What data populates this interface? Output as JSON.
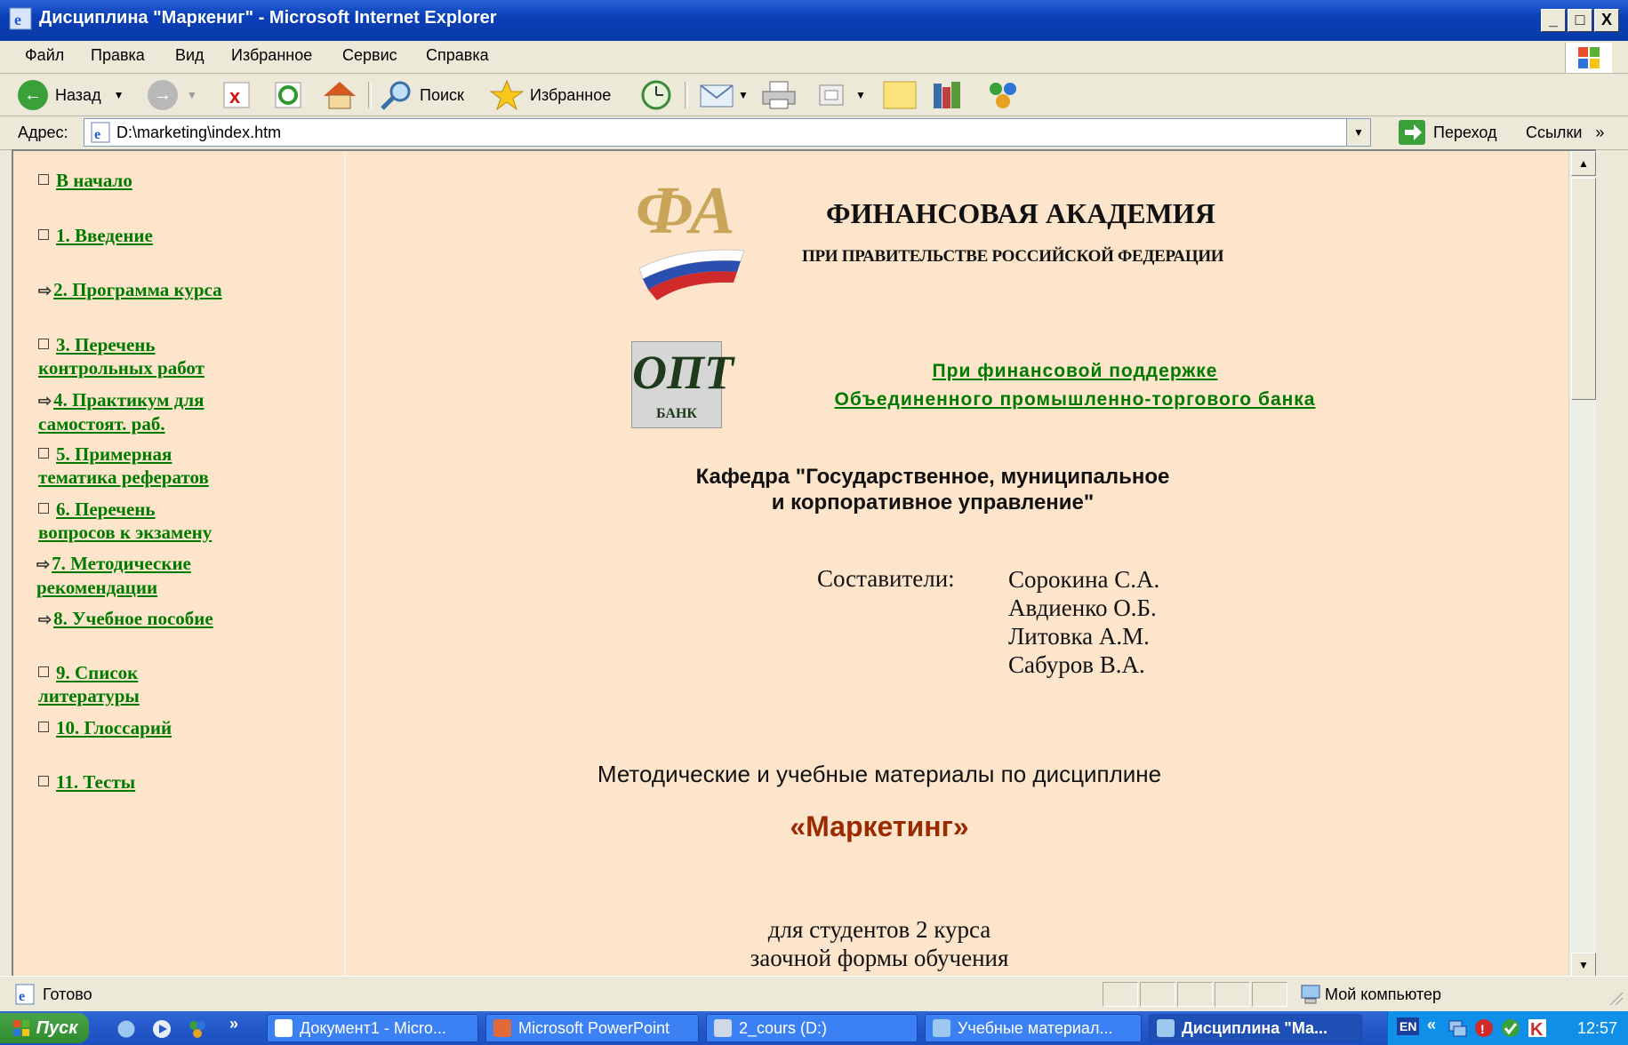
{
  "window": {
    "title": "Дисциплина \"Маркениг\" - Microsoft Internet Explorer",
    "controls": {
      "minimize": "_",
      "maximize": "□",
      "close": "X"
    }
  },
  "menu": [
    "Файл",
    "Правка",
    "Вид",
    "Избранное",
    "Сервис",
    "Справка"
  ],
  "toolbar": {
    "back": "Назад",
    "search": "Поиск",
    "favorites": "Избранное"
  },
  "address": {
    "label": "Адрес:",
    "value": "D:\\marketing\\index.htm",
    "go": "Переход",
    "links": "Ссылки",
    "more": "»"
  },
  "nav": [
    {
      "label": "В начало",
      "bullet": "square"
    },
    {
      "label": "1. Введение",
      "bullet": "square"
    },
    {
      "label": "2. Программа курса",
      "bullet": "arrow"
    },
    {
      "label": "3. Перечень контрольных работ",
      "bullet": "square",
      "line1": "3. Перечень",
      "line2": "контрольных работ"
    },
    {
      "label": "4. Практикум для самостоят. раб.",
      "bullet": "arrow",
      "line1": "4. Практикум для",
      "line2": "самостоят. раб."
    },
    {
      "label": "5. Примерная тематика рефератов",
      "bullet": "square",
      "line1": "5. Примерная",
      "line2": "тематика рефератов"
    },
    {
      "label": "6. Перечень вопросов к экзамену",
      "bullet": "square",
      "line1": "6. Перечень",
      "line2": "вопросов к экзамену"
    },
    {
      "label": "7. Методические рекомендации",
      "bullet": "arrow",
      "line1": "7. Методические",
      "line2": "рекомендации"
    },
    {
      "label": "8. Учебное пособие",
      "bullet": "arrow"
    },
    {
      "label": "9. Список литературы",
      "bullet": "square",
      "line1": "9. Список",
      "line2": "литературы"
    },
    {
      "label": "10. Глоссарий",
      "bullet": "square"
    },
    {
      "label": "11. Тесты",
      "bullet": "square"
    }
  ],
  "content": {
    "academy_title": "ФИНАНСОВАЯ АКАДЕМИЯ",
    "academy_subtitle": "ПРИ ПРАВИТЕЛЬСТВЕ РОССИЙСКОЙ ФЕДЕРАЦИИ",
    "bank_logo_letters": "ОПТ",
    "bank_logo_caption": "БАНК",
    "support_line1": "При финансовой поддержке",
    "support_line2": "Объединенного промышленно-торгового банка",
    "dept_line1": "Кафедра \"Государственное, муниципальное",
    "dept_line2": "и корпоративное управление\"",
    "authors_label": "Составители:",
    "authors": [
      "Сорокина С.А.",
      "Авдиенко О.Б.",
      "Литовка А.М.",
      "Сабуров В.А."
    ],
    "materials": "Методические и учебные материалы по дисциплине",
    "course": "«Маркетинг»",
    "students_line1": "для студентов 2 курса",
    "students_line2": "заочной формы обучения"
  },
  "status": {
    "text": "Готово",
    "zone": "Мой компьютер"
  },
  "taskbar": {
    "start": "Пуск",
    "quick_more": "»",
    "tasks": [
      "Документ1 - Micro...",
      "Microsoft PowerPoint",
      "2_cours (D:)",
      "Учебные материал...",
      "Дисциплина \"Ма..."
    ],
    "active_task": 4,
    "lang": "EN",
    "clock": "12:57"
  },
  "colors": {
    "link": "#007a00",
    "page_bg": "#fde5cb",
    "course_title": "#9c2a00",
    "titlebar": "#0a3fb7"
  }
}
